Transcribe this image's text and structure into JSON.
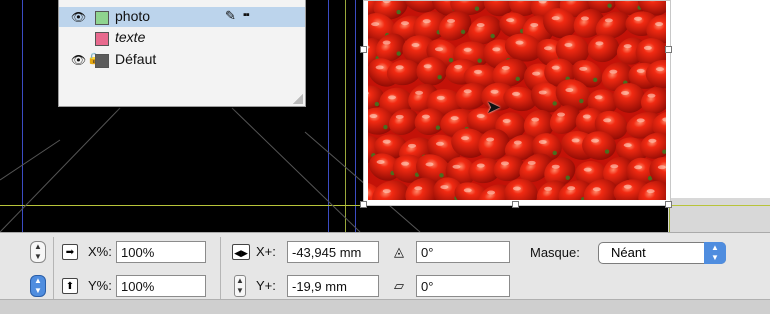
{
  "layers_panel": {
    "layers": [
      {
        "name": "photo",
        "color": "#8fd48f",
        "visible": true,
        "locked": false,
        "selected": true,
        "italic": false
      },
      {
        "name": "texte",
        "color": "#e86a8e",
        "visible": false,
        "locked": false,
        "selected": false,
        "italic": true
      },
      {
        "name": "Défaut",
        "color": "#5c5c5c",
        "visible": true,
        "locked": true,
        "selected": false,
        "italic": false
      }
    ]
  },
  "control_panel": {
    "scale_x_label": "X%:",
    "scale_x_value": "100%",
    "scale_y_label": "Y%:",
    "scale_y_value": "100%",
    "x_label": "X+:",
    "x_value": "-43,945 mm",
    "y_label": "Y+:",
    "y_value": "-19,9 mm",
    "angle_value": "0°",
    "shear_value": "0°",
    "mask_label": "Masque:",
    "mask_value": "Néant"
  },
  "colors": {
    "selection_blue": "#bcd4ec",
    "guide_blue": "#3b4cc4",
    "guide_yellow": "#b8c43a",
    "tomato_red": "#d8160c"
  },
  "icons": [
    "eye-icon",
    "lock-icon",
    "pen-icon",
    "grip-icon",
    "pointer-cursor-icon",
    "angle-icon",
    "shear-icon",
    "scale-x-icon",
    "scale-y-icon",
    "proxy-icon"
  ]
}
